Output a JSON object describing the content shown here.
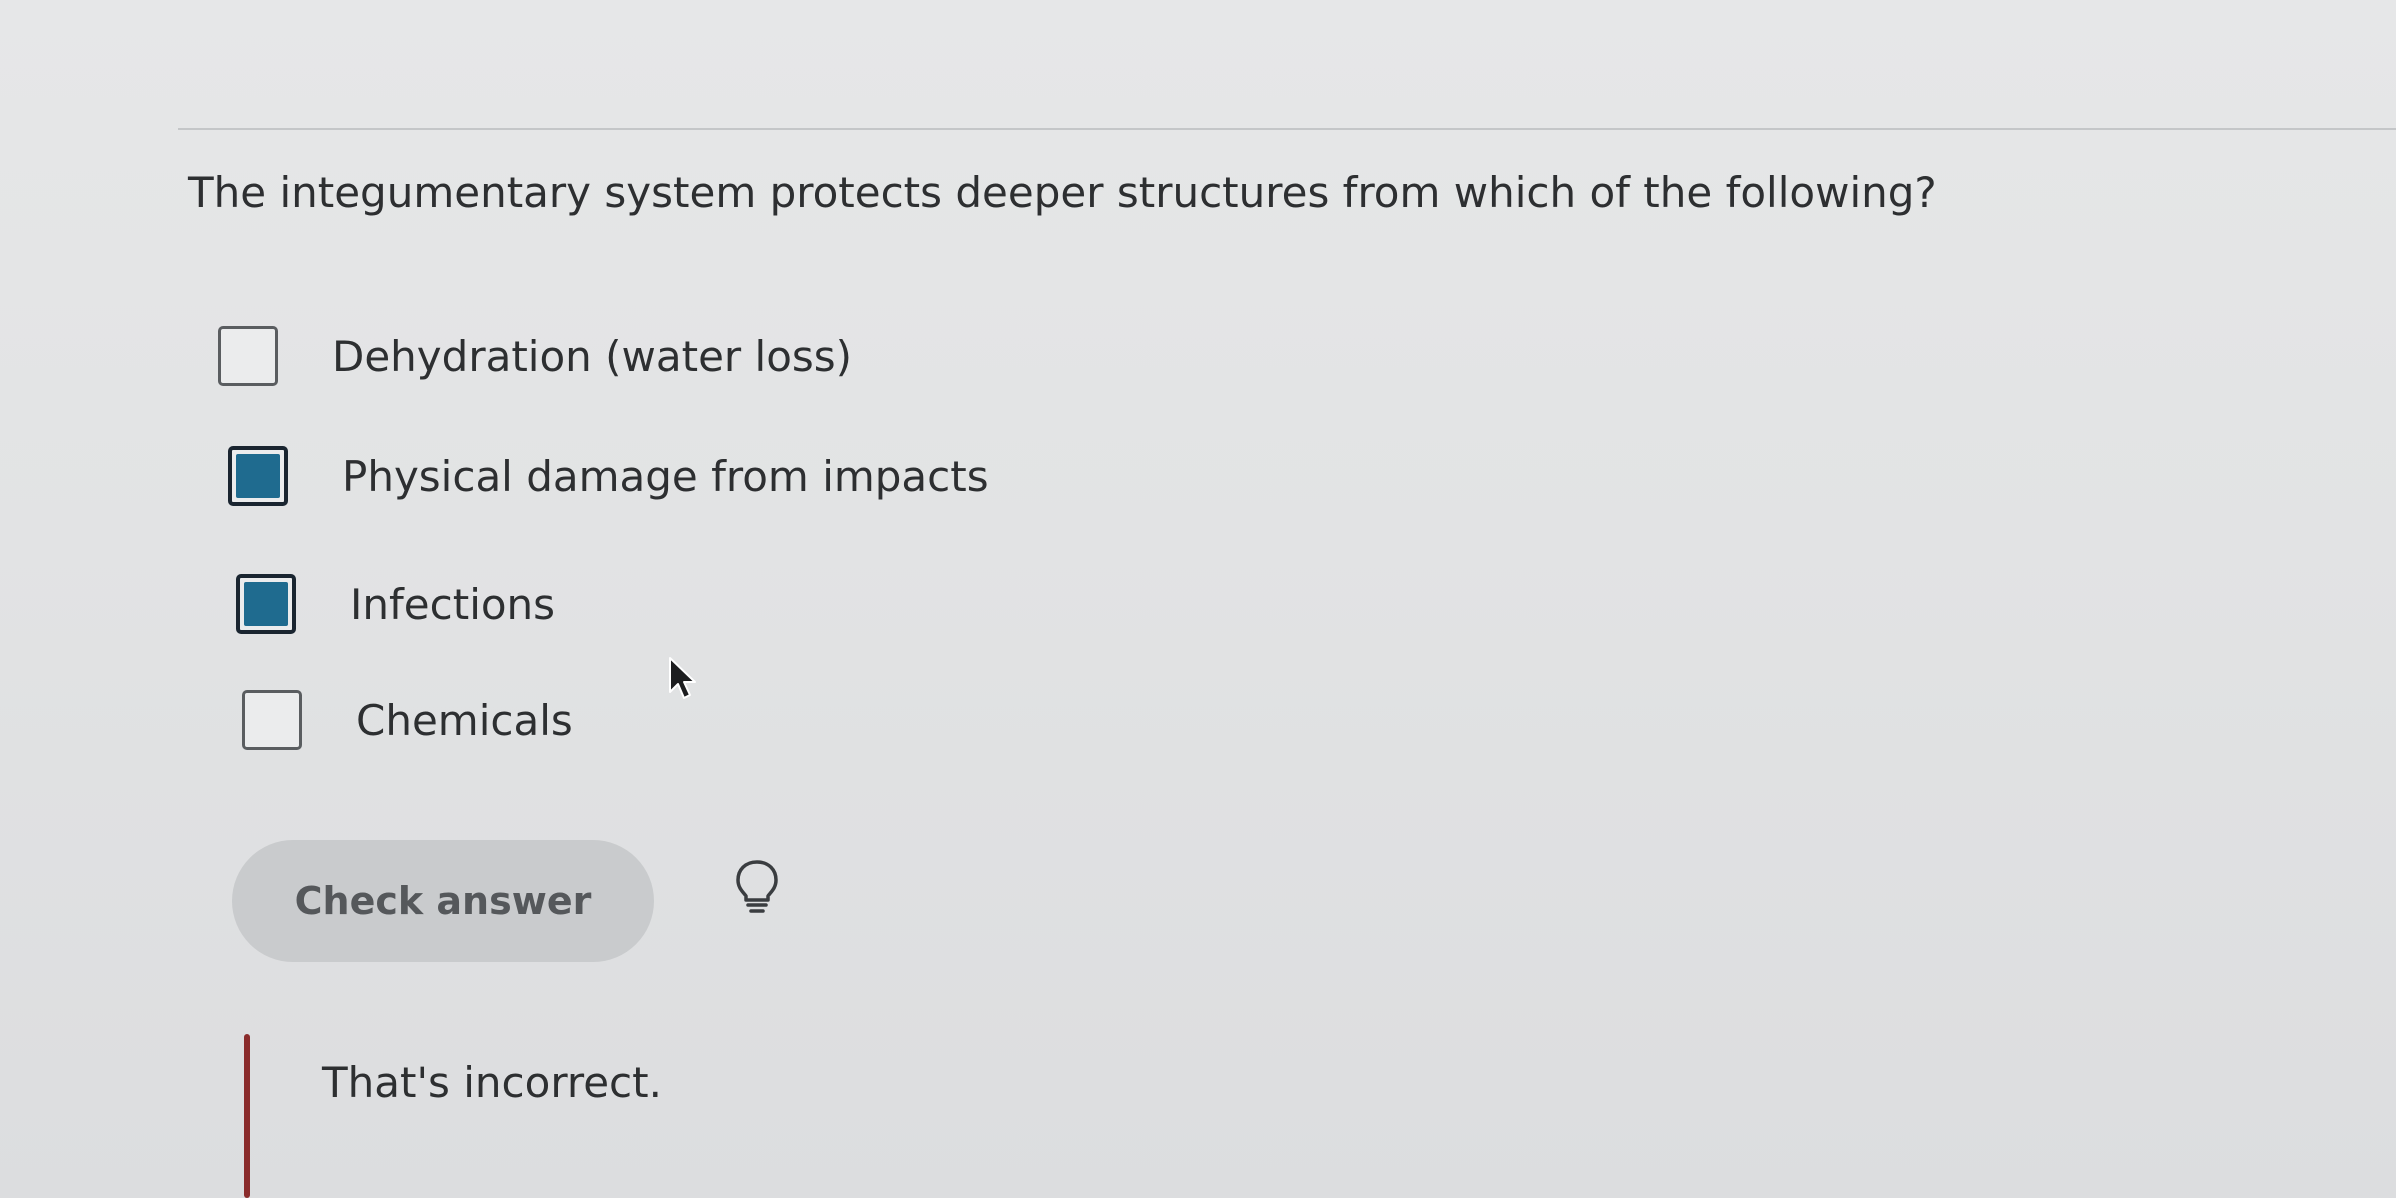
{
  "question": {
    "text": "The integumentary system protects deeper structures from which of the following?"
  },
  "options": [
    {
      "label": "Dehydration (water loss)",
      "checked": false
    },
    {
      "label": "Physical damage from impacts",
      "checked": true
    },
    {
      "label": "Infections",
      "checked": true
    },
    {
      "label": "Chemicals",
      "checked": false
    }
  ],
  "actions": {
    "check_answer_label": "Check answer",
    "hint_icon": "lightbulb-icon"
  },
  "feedback": {
    "text": "That's incorrect.",
    "status_color": "#8a2b2b"
  },
  "colors": {
    "checked_fill": "#1f6b8f",
    "button_bg": "#c9cbcd"
  }
}
